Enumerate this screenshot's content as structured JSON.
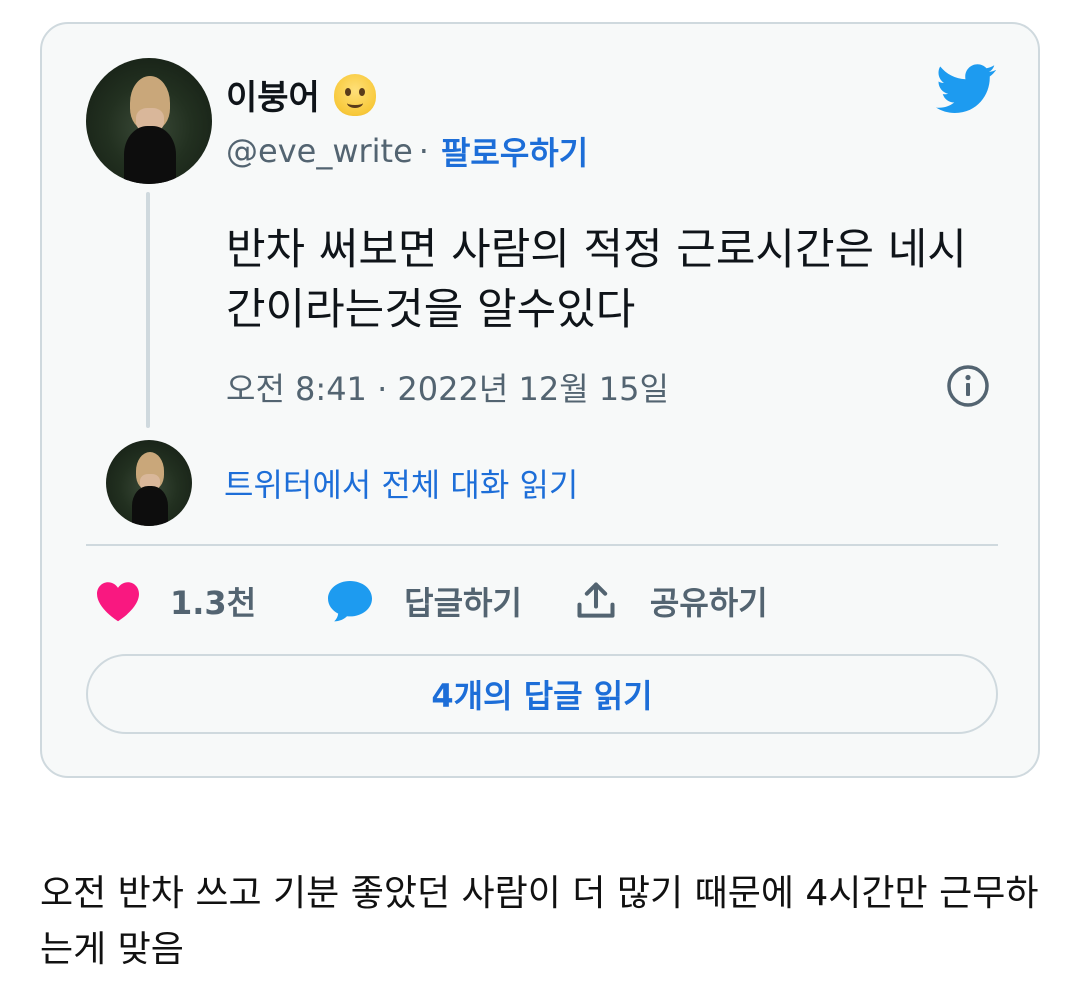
{
  "tweet": {
    "display_name": "이붕어",
    "handle": "@eve_write",
    "separator": "·",
    "follow_label": "팔로우하기",
    "text": "반차 써보면 사람의 적정 근로시간은 네시간이라는것을 알수있다",
    "time": "오전 8:41 · 2022년 12월 15일",
    "read_conversation": "트위터에서 전체 대화 읽기",
    "actions": {
      "like_count": "1.3천",
      "reply_label": "답글하기",
      "share_label": "공유하기"
    },
    "read_replies": "4개의 답글 읽기",
    "icons": {
      "emoji": "melting-face-emoji",
      "brand": "twitter-bird-icon",
      "info": "info-icon",
      "like": "heart-icon",
      "reply": "speech-bubble-icon",
      "share": "share-upload-icon"
    },
    "colors": {
      "brand_blue": "#1d9bf0",
      "link_blue": "#1d6ed8",
      "heart_pink": "#f91880",
      "muted": "#536471"
    }
  },
  "caption": "오전 반차 쓰고 기분 좋았던 사람이 더 많기 때문에 4시간만 근무하는게 맞음"
}
